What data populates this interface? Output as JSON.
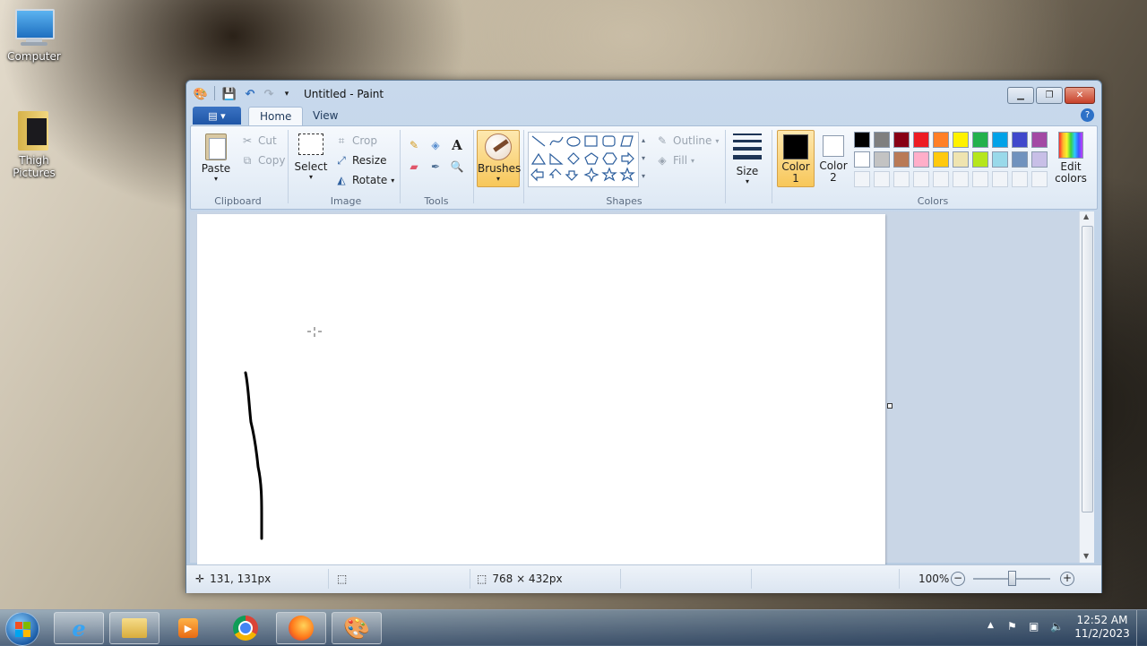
{
  "desktop": {
    "icons": [
      {
        "label": "Computer"
      },
      {
        "label": "Thigh Pictures"
      }
    ]
  },
  "window": {
    "title": "Untitled - Paint",
    "tabs": {
      "home": "Home",
      "view": "View"
    },
    "clipboard": {
      "paste": "Paste",
      "cut": "Cut",
      "copy": "Copy",
      "label": "Clipboard"
    },
    "image": {
      "select": "Select",
      "crop": "Crop",
      "resize": "Resize",
      "rotate": "Rotate",
      "label": "Image"
    },
    "tools": {
      "label": "Tools"
    },
    "brushes": "Brushes",
    "shapes": {
      "outline": "Outline",
      "fill": "Fill",
      "label": "Shapes"
    },
    "size": "Size",
    "color1": {
      "line1": "Color",
      "line2": "1"
    },
    "color2": {
      "line1": "Color",
      "line2": "2"
    },
    "colors_label": "Colors",
    "edit_colors": {
      "line1": "Edit",
      "line2": "colors"
    },
    "palette": [
      "#000000",
      "#7f7f7f",
      "#880015",
      "#ed1c24",
      "#ff7f27",
      "#fff200",
      "#22b14c",
      "#00a2e8",
      "#3f48cc",
      "#a349a4",
      "#ffffff",
      "#c3c3c3",
      "#b97a57",
      "#ffaec9",
      "#ffc90e",
      "#efe4b0",
      "#b5e61d",
      "#99d9ea",
      "#7092be",
      "#c8bfe7"
    ],
    "color1_value": "#000000",
    "color2_value": "#ffffff"
  },
  "status": {
    "cursor_pos": "131, 131px",
    "canvas_size": "768 × 432px",
    "zoom": "100%"
  },
  "taskbar": {
    "time": "12:52 AM",
    "date": "11/2/2023"
  }
}
